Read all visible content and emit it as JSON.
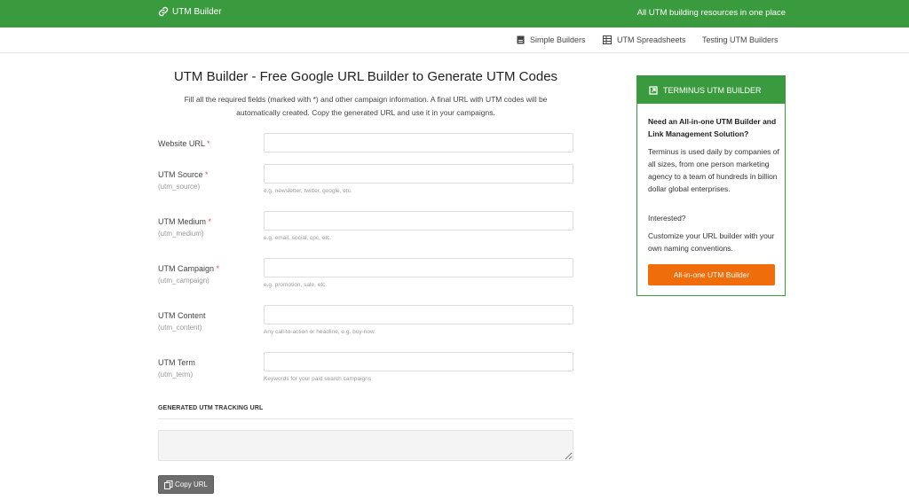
{
  "header": {
    "brand": "UTM Builder",
    "tagline": "All UTM building resources in one place"
  },
  "subnav": {
    "items": [
      {
        "label": "Simple Builders",
        "icon": "document-icon"
      },
      {
        "label": "UTM Spreadsheets",
        "icon": "spreadsheet-icon"
      },
      {
        "label": "Testing UTM Builders",
        "icon": ""
      }
    ]
  },
  "main": {
    "title": "UTM Builder - Free Google URL Builder to Generate UTM Codes",
    "intro": "Fill all the required fields (marked with *) and other campaign information. A final URL with UTM codes will be automatically created. Copy the generated URL and use it in your campaigns.",
    "fields": [
      {
        "label": "Website URL",
        "required": "*",
        "param": "",
        "value": "",
        "help": ""
      },
      {
        "label": "UTM Source",
        "required": "*",
        "param": "(utm_source)",
        "value": "",
        "help": "e.g. newsletter, twitter, google, etc."
      },
      {
        "label": "UTM Medium",
        "required": "*",
        "param": "(utm_medium)",
        "value": "",
        "help": "e.g. email, social, cpc, etc."
      },
      {
        "label": "UTM Campaign",
        "required": "*",
        "param": "(utm_campaign)",
        "value": "",
        "help": "e.g. promotion, sale, etc."
      },
      {
        "label": "UTM Content",
        "required": "",
        "param": "(utm_content)",
        "value": "",
        "help": "Any call-to-action or headline, e.g. buy-now."
      },
      {
        "label": "UTM Term",
        "required": "",
        "param": "(utm_term)",
        "value": "",
        "help": "Keywords for your paid search campaigns"
      }
    ],
    "generated_heading": "GENERATED UTM TRACKING URL",
    "generated_value": "",
    "copy_label": "Copy URL"
  },
  "sidebar": {
    "heading": "TERMINUS UTM BUILDER",
    "question": "Need an All-in-one UTM Builder and Link Management Solution?",
    "para1": "Terminus is used daily by companies of all sizes, from one person marketing agency to a team of hundreds in billion dollar global enterprises.",
    "para2": "Interested?",
    "para3": "Customize your URL builder with your own naming conventions.",
    "button": "All-in-one UTM Builder"
  },
  "colors": {
    "brand_green": "#3a9a3e",
    "cta_orange": "#ef6d0a",
    "required_red": "#d9534f"
  }
}
